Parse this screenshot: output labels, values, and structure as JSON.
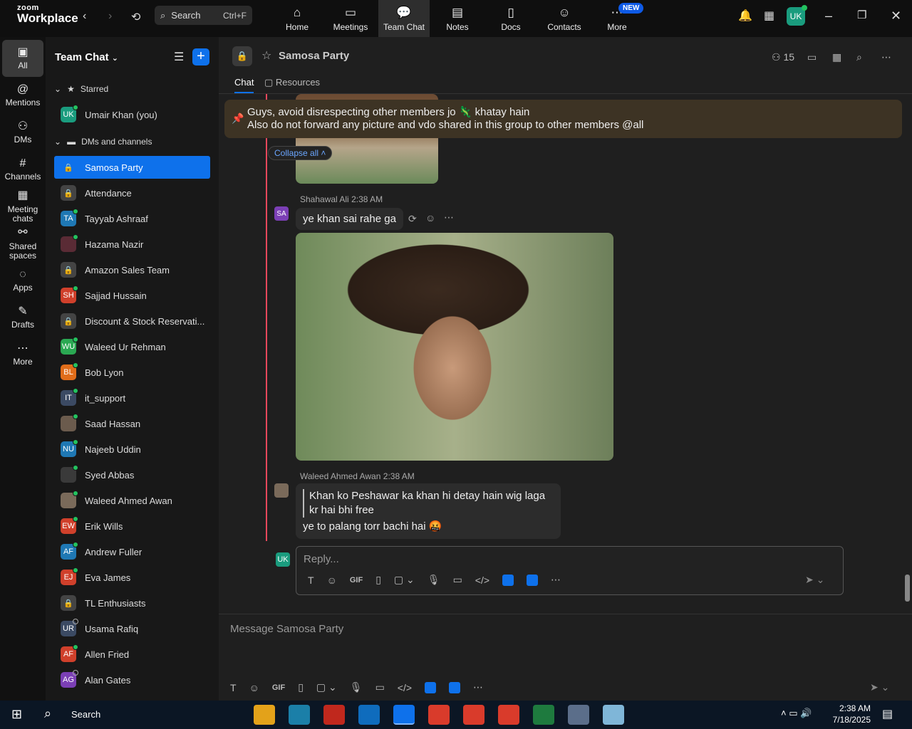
{
  "app": {
    "logo_top": "zoom",
    "logo_bottom": "Workplace",
    "search_label": "Search",
    "search_shortcut": "Ctrl+F",
    "new_badge": "NEW",
    "user_initials": "UK"
  },
  "top_tabs": [
    {
      "label": "Home",
      "icon": "⌂"
    },
    {
      "label": "Meetings",
      "icon": "▭"
    },
    {
      "label": "Team Chat",
      "icon": "💬"
    },
    {
      "label": "Notes",
      "icon": "▤"
    },
    {
      "label": "Docs",
      "icon": "▯"
    },
    {
      "label": "Contacts",
      "icon": "☺"
    },
    {
      "label": "More",
      "icon": "⋯"
    }
  ],
  "rail": [
    {
      "label": "All",
      "icon": "▣"
    },
    {
      "label": "Mentions",
      "icon": "@"
    },
    {
      "label": "DMs",
      "icon": "⚇"
    },
    {
      "label": "Channels",
      "icon": "#"
    },
    {
      "label": "Meeting chats",
      "icon": "▦"
    },
    {
      "label": "Shared spaces",
      "icon": "⚯"
    },
    {
      "label": "Apps",
      "icon": "◌"
    },
    {
      "label": "Drafts",
      "icon": "✎"
    },
    {
      "label": "More",
      "icon": "⋯"
    }
  ],
  "sidebar": {
    "title": "Team Chat",
    "starred": "Starred",
    "dms": "DMs and channels",
    "starred_items": [
      {
        "name": "Umair Khan (you)",
        "initials": "UK",
        "color": "#1a9c7e"
      }
    ],
    "items": [
      {
        "name": "Samosa Party",
        "initials": "🔒",
        "color": "#0e71eb",
        "lock": true
      },
      {
        "name": "Attendance",
        "initials": "🔒",
        "color": "#444",
        "lock": true
      },
      {
        "name": "Tayyab Ashraaf",
        "initials": "TA",
        "color": "#1f78b4"
      },
      {
        "name": "Hazama Nazir",
        "initials": "",
        "color": "#5a2b35"
      },
      {
        "name": "Amazon Sales Team",
        "initials": "🔒",
        "color": "#444",
        "lock": true
      },
      {
        "name": "Sajjad Hussain",
        "initials": "SH",
        "color": "#d0402b"
      },
      {
        "name": "Discount & Stock Reservati...",
        "initials": "🔒",
        "color": "#444",
        "lock": true
      },
      {
        "name": "Waleed Ur Rehman",
        "initials": "WU",
        "color": "#2aa852"
      },
      {
        "name": "Bob Lyon",
        "initials": "BL",
        "color": "#e06d1a"
      },
      {
        "name": "it_support",
        "initials": "IT",
        "color": "#3b4a63"
      },
      {
        "name": "Saad Hassan",
        "initials": "",
        "color": "#6b5b4d"
      },
      {
        "name": "Najeeb Uddin",
        "initials": "NU",
        "color": "#1f78b4"
      },
      {
        "name": "Syed Abbas",
        "initials": "",
        "color": "#3a3a3a"
      },
      {
        "name": "Waleed Ahmed Awan",
        "initials": "",
        "color": "#7a6a5a"
      },
      {
        "name": "Erik Wills",
        "initials": "EW",
        "color": "#d0402b"
      },
      {
        "name": "Andrew Fuller",
        "initials": "AF",
        "color": "#1f78b4"
      },
      {
        "name": "Eva James",
        "initials": "EJ",
        "color": "#d0402b"
      },
      {
        "name": "TL Enthusiasts",
        "initials": "🔒",
        "color": "#444",
        "lock": true
      },
      {
        "name": "Usama Rafiq",
        "initials": "UR",
        "color": "#3b4a63",
        "offline": true
      },
      {
        "name": "Allen Fried",
        "initials": "AF",
        "color": "#d0402b"
      },
      {
        "name": "Alan Gates",
        "initials": "AG",
        "color": "#7b3fb5",
        "offline": true
      }
    ]
  },
  "chat": {
    "title": "Samosa Party",
    "member_count": "15",
    "tabs": [
      "Chat",
      "Resources"
    ],
    "pinned_line1": "Guys, avoid disrespecting other members jo 🦎 khatay hain",
    "pinned_line2": "Also do not forward any picture and vdo shared in this group to other members @all",
    "collapse": "Collapse all",
    "msg1_sender": "Shahawal Ali",
    "msg1_time": "2:38 AM",
    "msg1_initials": "SA",
    "msg1_text": "ye khan sai rahe ga",
    "msg2_sender": "Waleed Ahmed Awan",
    "msg2_time": "2:38 AM",
    "msg2_quote": "Khan ko Peshawar ka khan hi detay hain wig laga kr hai bhi free",
    "msg2_text": "ye to palang torr bachi hai 🤬",
    "reply_placeholder": "Reply...",
    "reply_initials": "UK",
    "message_placeholder": "Message Samosa Party"
  },
  "taskbar": {
    "search": "Search",
    "time": "2:38 AM",
    "date": "7/18/2025"
  }
}
